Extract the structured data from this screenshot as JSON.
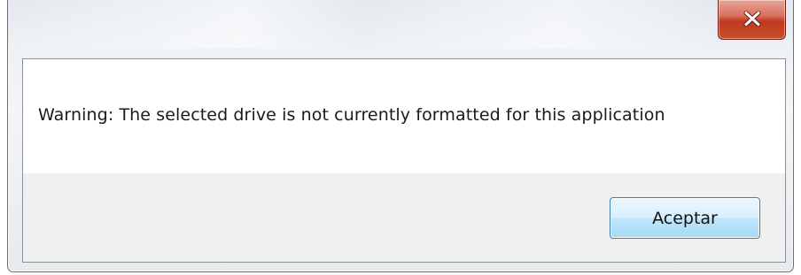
{
  "dialog": {
    "close_label": "X",
    "message": "Warning: The selected drive is not currently formatted for this application",
    "ok_label": "Aceptar"
  },
  "colors": {
    "close_button": "#c8502f",
    "ok_button_border": "#3c7fb1",
    "panel_background": "#f0f0f0"
  },
  "icons": [
    "close-icon"
  ]
}
